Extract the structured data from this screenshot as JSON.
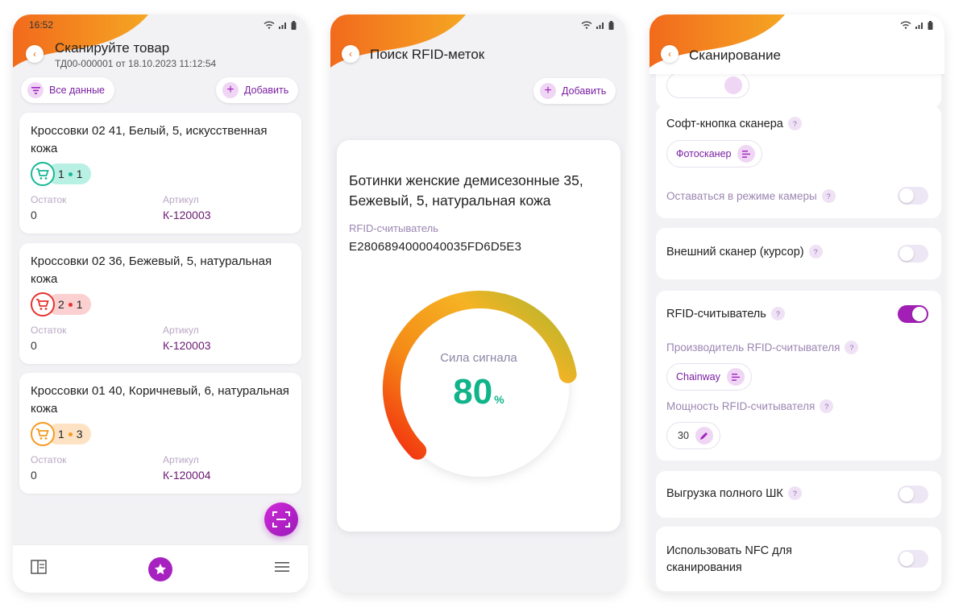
{
  "colors": {
    "accent": "#a721c0",
    "orange": "#f26a1c",
    "teal": "#10b38a",
    "red": "#e5322d"
  },
  "screen1": {
    "time": "16:52",
    "title": "Сканируйте товар",
    "subtitle": "ТД00-000001 от 18.10.2023 11:12:54",
    "filter_label": "Все данные",
    "add_label": "Добавить",
    "items": [
      {
        "name": "Кроссовки 02 41, Белый, 5, искусственная кожа",
        "left": "1",
        "right": "1",
        "stock_label": "Остаток",
        "stock": "0",
        "sku_label": "Артикул",
        "sku": "К-120003",
        "status_color": "#17b896",
        "badge_bg": "#b9f0e4"
      },
      {
        "name": "Кроссовки 02 36, Бежевый, 5, натуральная кожа",
        "left": "2",
        "right": "1",
        "stock_label": "Остаток",
        "stock": "0",
        "sku_label": "Артикул",
        "sku": "К-120003",
        "status_color": "#e5322d",
        "badge_bg": "#fbd0d0"
      },
      {
        "name": "Кроссовки 01 40, Коричневый, 6, натуральная кожа",
        "left": "1",
        "right": "3",
        "stock_label": "Остаток",
        "stock": "0",
        "sku_label": "Артикул",
        "sku": "К-120004",
        "status_color": "#f59a22",
        "badge_bg": "#fde3c4"
      }
    ]
  },
  "screen2": {
    "title": "Поиск RFID-меток",
    "add_label": "Добавить",
    "product": "Ботинки женские демисезонные 35, Бежевый, 5, натуральная кожа",
    "reader_label": "RFID-считыватель",
    "tag_code": "E2806894000040035FD6D5E3",
    "signal_label": "Сила сигнала",
    "signal_value": "80",
    "signal_unit": "%",
    "signal_fraction": 0.8
  },
  "screen3": {
    "title": "Сканирование",
    "soft_button_label": "Софт-кнопка сканера",
    "soft_button_value": "Фотосканер",
    "camera_mode_label": "Оставаться в режиме камеры",
    "external_scanner_label": "Внешний сканер (курсор)",
    "rfid_reader_label": "RFID-считыватель",
    "manufacturer_label": "Производитель RFID-считывателя",
    "manufacturer_value": "Chainway",
    "power_label": "Мощность RFID-считывателя",
    "power_value": "30",
    "full_barcode_label": "Выгрузка полного ШК",
    "nfc_label": "Использовать NFC для сканирования",
    "help_glyph": "?",
    "toggles": {
      "camera_mode": false,
      "external_scanner": false,
      "rfid_reader": true,
      "full_barcode": false,
      "nfc": false
    }
  }
}
